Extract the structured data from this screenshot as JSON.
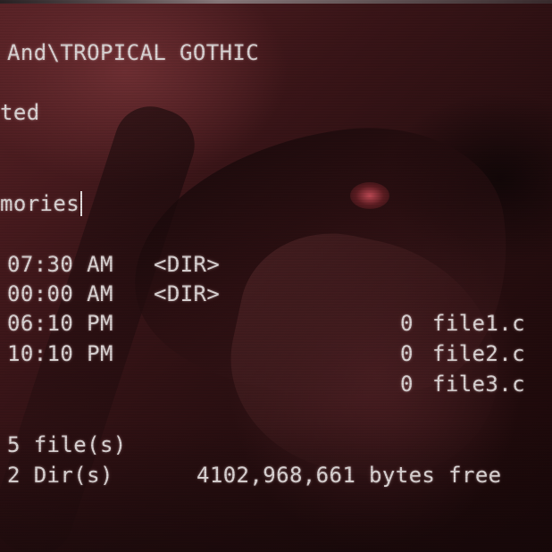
{
  "terminal": {
    "path_line": "And\\TROPICAL GOTHIC",
    "line2": "ted",
    "prompt_line": "mories",
    "entries": [
      {
        "time": "07:30 AM",
        "type": "<DIR>",
        "size": "",
        "name": ""
      },
      {
        "time": "00:00 AM",
        "type": "<DIR>",
        "size": "",
        "name": ""
      },
      {
        "time": "06:10 PM",
        "type": "",
        "size": "0",
        "name": "file1.c"
      },
      {
        "time": "10:10 PM",
        "type": "",
        "size": "0",
        "name": "file2.c"
      },
      {
        "time": "",
        "type": "",
        "size": "0",
        "name": "file3.c"
      }
    ],
    "summary_files": "5 file(s)",
    "summary_dirs": "2 Dir(s)",
    "bytes_free": "4102,968,661 bytes free"
  },
  "colors": {
    "text": "#dcd6d6",
    "background_tint": "#5b2327"
  }
}
